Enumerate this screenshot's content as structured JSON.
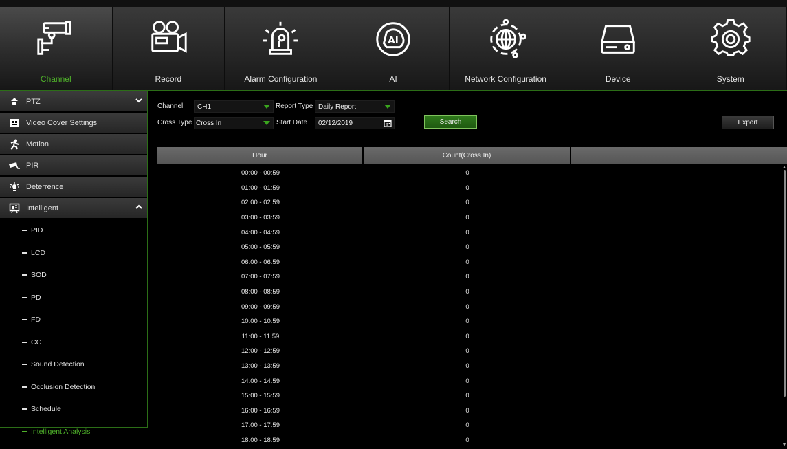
{
  "topnav": {
    "items": [
      {
        "label": "Channel",
        "icon": "camera-icon",
        "active": true
      },
      {
        "label": "Record",
        "icon": "video-camera-icon",
        "active": false
      },
      {
        "label": "Alarm Configuration",
        "icon": "alarm-light-icon",
        "active": false
      },
      {
        "label": "AI",
        "icon": "ai-icon",
        "active": false
      },
      {
        "label": "Network Configuration",
        "icon": "globe-network-icon",
        "active": false
      },
      {
        "label": "Device",
        "icon": "hard-drive-icon",
        "active": false
      },
      {
        "label": "System",
        "icon": "gear-icon",
        "active": false
      }
    ]
  },
  "sidebar": {
    "items": [
      {
        "label": "PTZ",
        "icon": "ptz-camera-icon",
        "chevron": "down"
      },
      {
        "label": "Video Cover Settings",
        "icon": "video-cover-icon"
      },
      {
        "label": "Motion",
        "icon": "running-person-icon"
      },
      {
        "label": "PIR",
        "icon": "pir-sensor-icon"
      },
      {
        "label": "Deterrence",
        "icon": "light-bulb-icon"
      },
      {
        "label": "Intelligent",
        "icon": "intelligent-icon",
        "chevron": "up"
      }
    ],
    "subitems": [
      {
        "label": "PID",
        "active": false
      },
      {
        "label": "LCD",
        "active": false
      },
      {
        "label": "SOD",
        "active": false
      },
      {
        "label": "PD",
        "active": false
      },
      {
        "label": "FD",
        "active": false
      },
      {
        "label": "CC",
        "active": false
      },
      {
        "label": "Sound Detection",
        "active": false
      },
      {
        "label": "Occlusion Detection",
        "active": false
      },
      {
        "label": "Schedule",
        "active": false
      },
      {
        "label": "Intelligent Analysis",
        "active": true
      }
    ]
  },
  "filters": {
    "channel_label": "Channel",
    "channel_value": "CH1",
    "report_type_label": "Report Type",
    "report_type_value": "Daily Report",
    "cross_type_label": "Cross Type",
    "cross_type_value": "Cross In",
    "start_date_label": "Start Date",
    "start_date_value": "02/12/2019",
    "search_label": "Search",
    "export_label": "Export"
  },
  "table": {
    "columns": [
      "Hour",
      "Count(Cross In)",
      ""
    ],
    "rows": [
      {
        "hour": "00:00 - 00:59",
        "count": "0"
      },
      {
        "hour": "01:00 - 01:59",
        "count": "0"
      },
      {
        "hour": "02:00 - 02:59",
        "count": "0"
      },
      {
        "hour": "03:00 - 03:59",
        "count": "0"
      },
      {
        "hour": "04:00 - 04:59",
        "count": "0"
      },
      {
        "hour": "05:00 - 05:59",
        "count": "0"
      },
      {
        "hour": "06:00 - 06:59",
        "count": "0"
      },
      {
        "hour": "07:00 - 07:59",
        "count": "0"
      },
      {
        "hour": "08:00 - 08:59",
        "count": "0"
      },
      {
        "hour": "09:00 - 09:59",
        "count": "0"
      },
      {
        "hour": "10:00 - 10:59",
        "count": "0"
      },
      {
        "hour": "11:00 - 11:59",
        "count": "0"
      },
      {
        "hour": "12:00 - 12:59",
        "count": "0"
      },
      {
        "hour": "13:00 - 13:59",
        "count": "0"
      },
      {
        "hour": "14:00 - 14:59",
        "count": "0"
      },
      {
        "hour": "15:00 - 15:59",
        "count": "0"
      },
      {
        "hour": "16:00 - 16:59",
        "count": "0"
      },
      {
        "hour": "17:00 - 17:59",
        "count": "0"
      },
      {
        "hour": "18:00 - 18:59",
        "count": "0"
      }
    ]
  },
  "colors": {
    "accent_green": "#4fb22a",
    "header_gray": "#5f5f5f",
    "background": "#000000"
  }
}
